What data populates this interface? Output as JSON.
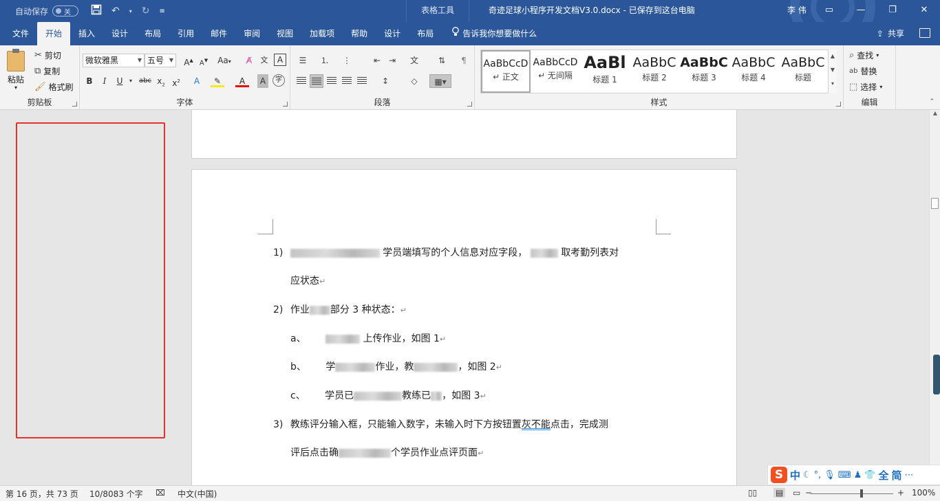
{
  "titlebar": {
    "autosave_label": "自动保存",
    "autosave_state": "关",
    "context_tab": "表格工具",
    "doc_title": "奇迹足球小程序开发文档V3.0.docx  -  已保存到这台电脑",
    "user": "李 伟"
  },
  "tabs": {
    "file": "文件",
    "home": "开始",
    "insert": "插入",
    "design": "设计",
    "layout": "布局",
    "references": "引用",
    "mailings": "邮件",
    "review": "审阅",
    "view": "视图",
    "addins": "加载项",
    "help": "帮助",
    "table_design": "设计",
    "table_layout": "布局",
    "tell_me": "告诉我你想要做什么",
    "share": "共享"
  },
  "ribbon": {
    "clipboard": {
      "label": "剪贴板",
      "paste": "粘贴",
      "cut": "剪切",
      "copy": "复制",
      "format_painter": "格式刷"
    },
    "font": {
      "label": "字体",
      "font_name": "微软雅黑",
      "font_size": "五号",
      "case": "Aa"
    },
    "paragraph": {
      "label": "段落"
    },
    "styles": {
      "label": "样式",
      "items": [
        {
          "sample": "AaBbCcD",
          "name": "↵ 正文"
        },
        {
          "sample": "AaBbCcD",
          "name": "↵ 无间隔"
        },
        {
          "sample": "AaBl",
          "name": "标题 1"
        },
        {
          "sample": "AaBbC",
          "name": "标题 2"
        },
        {
          "sample": "AaBbC",
          "name": "标题 3"
        },
        {
          "sample": "AaBbC",
          "name": "标题 4"
        },
        {
          "sample": "AaBbC",
          "name": "标题"
        }
      ]
    },
    "editing": {
      "label": "编辑",
      "find": "查找",
      "replace": "替换",
      "select": "选择"
    }
  },
  "document": {
    "p1_num": "1)",
    "p1_a": "学员端填写的个人信息对应字段，",
    "p1_b": "取考勤列表对",
    "p1_cont": "应状态",
    "p2_num": "2)",
    "p2_a": "作业",
    "p2_b": "部分 3 种状态：",
    "pa_num": "a、",
    "pa_a": "上传作业，如图 1",
    "pb_num": "b、",
    "pb_a": "学",
    "pb_b": "作业，教",
    "pb_c": "，如图 2",
    "pc_num": "c、",
    "pc_a": "学员已",
    "pc_b": "教练已",
    "pc_c": "，如图 3",
    "p3_num": "3)",
    "p3_a": "教练评分输入框，只能输入数字，未输入时下方按钮置",
    "p3_b": "灰不能",
    "p3_c": "点击，完成测",
    "p3_cont_a": "评后点击确",
    "p3_cont_b": "个学员作业点评页面"
  },
  "ime": {
    "lang": "中",
    "full": "全",
    "simp": "简"
  },
  "statusbar": {
    "page": "第 16 页，共 73 页",
    "words": "10/8083 个字",
    "language": "中文(中国)",
    "zoom": "100%"
  },
  "colors": {
    "brand": "#2b579a",
    "highlight_box": "#e8302a"
  }
}
